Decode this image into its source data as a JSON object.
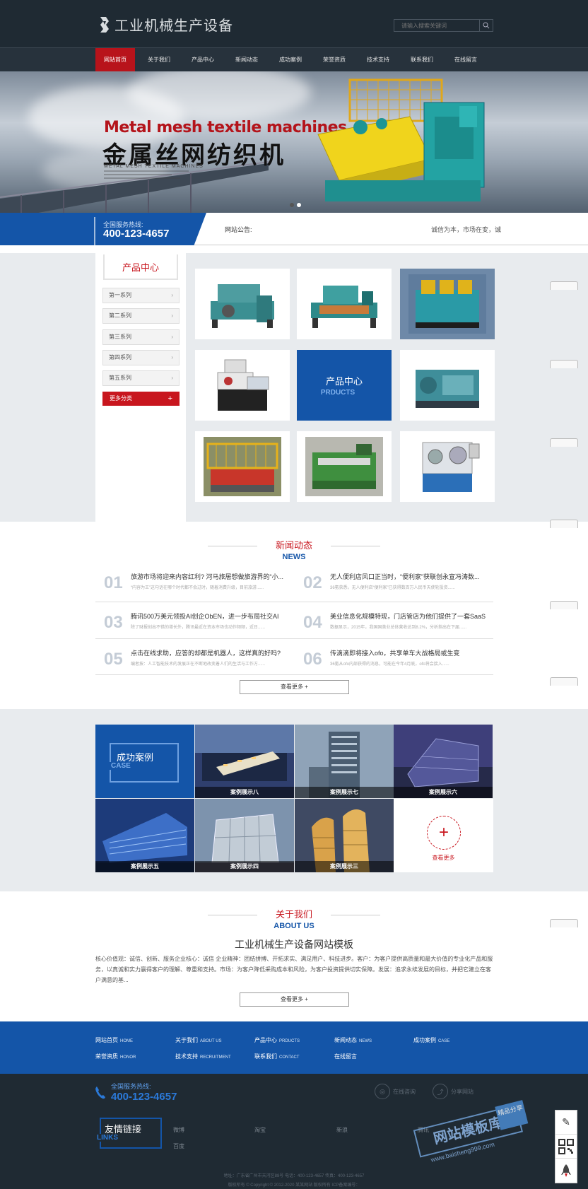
{
  "header": {
    "logo_text": "工业机械生产设备",
    "search_placeholder": "请输入搜索关键词",
    "nav": [
      "网站首页",
      "关于我们",
      "产品中心",
      "新闻动态",
      "成功案例",
      "荣誉资质",
      "技术支持",
      "联系我们",
      "在线留言"
    ],
    "active_nav": "网站首页"
  },
  "banner": {
    "en_title": "Metal mesh textile machines",
    "cn_title": "金属丝网纺织机",
    "sub": "METAL MESH TEXTILE MACHINES"
  },
  "hotline": {
    "label": "全国服务热线:",
    "number": "400-123-4657",
    "notice_label": "网站公告:",
    "notice_text": "诚信为本，市场在变，诚"
  },
  "products": {
    "heading": "产品中心",
    "categories": [
      "第一系列",
      "第二系列",
      "第三系列",
      "第四系列",
      "第五系列"
    ],
    "more_label": "更多分类",
    "center_cn": "产品中心",
    "center_en": "PRDUCTS"
  },
  "news": {
    "title_cn": "新闻动态",
    "title_en": "NEWS",
    "items": [
      {
        "num": "01",
        "title": "旅游市场将迎来内容红利? 河马旅居想做旅游界的“小...",
        "desc": "“内容为王”这句话在哪个时代都不会过时，随着消费升级，目前旅游......"
      },
      {
        "num": "02",
        "title": "无人便利店风口正当时，“便利家”获联创永宣冯涛数...",
        "desc": "36氪获悉，无人便利店“便利家”已获得数百万人民币天使轮投资......"
      },
      {
        "num": "03",
        "title": "腾讯500万美元领投AI创企ObEN，进一步布局社交AI",
        "desc": "除了财报创出不错的增长外，腾讯最近在资本市场也动作频频，近日......"
      },
      {
        "num": "04",
        "title": "美业信息化规模特现，门店管店为他们提供了一套SaaS...",
        "desc": "数据显示，2015年，我国国美业总体营收达到8.2%，分析指出在下届......"
      },
      {
        "num": "05",
        "title": "点击在线求助，应答的却都是机器人，这样真的好吗?",
        "desc": "编者按：人工智能技术的发展正在不断地改变着人们的生活与工作方......"
      },
      {
        "num": "06",
        "title": "传滴滴即将接入ofo，共享单车大战格局或生变",
        "desc": "36氪从ofo内部获得的消息，可能在今年4月底，ofo将会接入......"
      }
    ],
    "more": "查看更多"
  },
  "cases": {
    "title_cn": "成功案例",
    "title_en": "CASE",
    "items": [
      "案例展示八",
      "案例展示七",
      "案例展示六",
      "案例展示五",
      "案例展示四",
      "案例展示三"
    ],
    "more": "查看更多"
  },
  "about": {
    "title_cn": "关于我们",
    "title_en": "ABOUT US",
    "heading": "工业机械生产设备网站模板",
    "text": "核心价值观：诚信、创新、服务企业核心：诚信 企业精神：团结拼搏、开拓求实、满足用户、科技进步。客户：为客户提供高质量和最大价值的专业化产品和服务，以真诚和实力赢得客户的理解、尊重和支持。市场：为客户降低采购成本和风险，为客户投资提供切实保障。发展：追求永续发展的目标，并把它建立在客户满意的基...",
    "more": "查看更多"
  },
  "footer_nav": [
    {
      "cn": "网站首页",
      "en": "HOME"
    },
    {
      "cn": "关于我们",
      "en": "ABOUT US"
    },
    {
      "cn": "产品中心",
      "en": "PRDUCTS"
    },
    {
      "cn": "新闻动态",
      "en": "NEWS"
    },
    {
      "cn": "成功案例",
      "en": "CASE"
    },
    {
      "cn": "荣誉资质",
      "en": "HONOR"
    },
    {
      "cn": "技术支持",
      "en": "RECRUITMENT"
    },
    {
      "cn": "联系我们",
      "en": "CONTACT"
    },
    {
      "cn": "在线留言",
      "en": ""
    }
  ],
  "footer": {
    "hot_label": "全国服务热线:",
    "hot_number": "400-123-4657",
    "social": [
      "在线咨询",
      "分享网站"
    ],
    "links_cn": "友情链接",
    "links_en": "LINKS",
    "links": [
      "微博",
      "淘宝",
      "新浪",
      "腾讯",
      "百度"
    ],
    "addr": "地址：广东省广州市天河区88号    电话：400-123-4657    传真：400-123-4657",
    "copyright": "版权所有 © Copyright © 2012-2020  某某网站 版权所有         ICP备案编号：",
    "watermark_cn": "网站模板库",
    "watermark_url": "www.baisheng999.com",
    "watermark_badge": "精品分享"
  },
  "colors": {
    "brand_red": "#c8161e",
    "brand_blue": "#1455a8",
    "dark": "#1f2a33"
  }
}
